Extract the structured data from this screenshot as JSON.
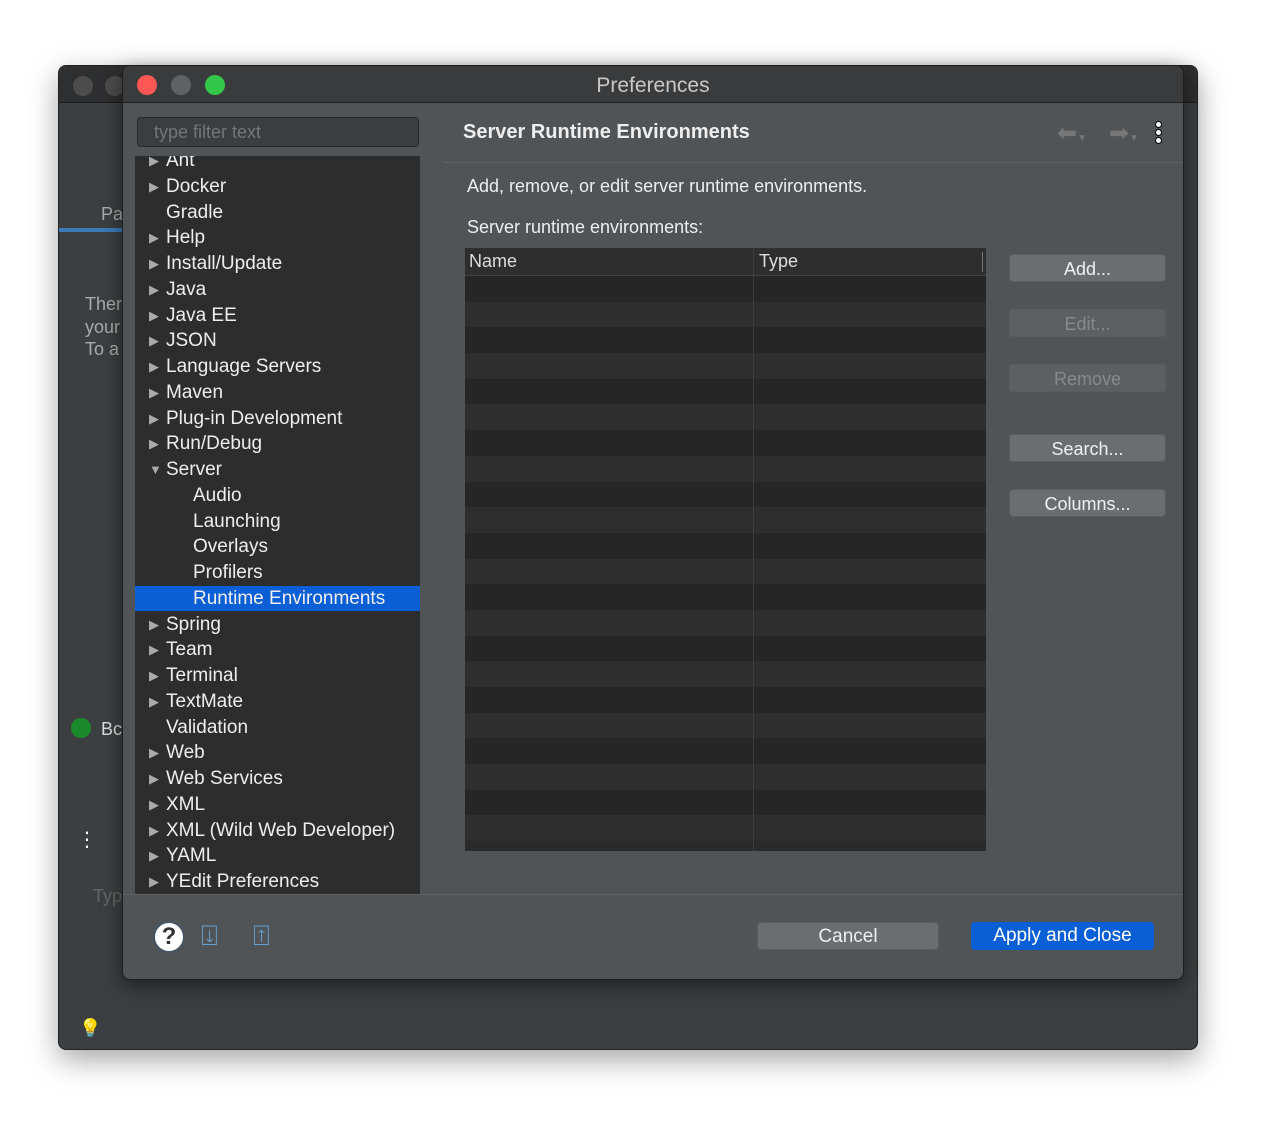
{
  "background_window": {
    "partial_texts": [
      "Pa",
      "Ther",
      "your",
      "To a",
      "Bc",
      "Typ"
    ]
  },
  "dialog": {
    "title": "Preferences"
  },
  "filter": {
    "placeholder": "type filter text"
  },
  "tree": [
    {
      "label": "Ant",
      "expandable": true
    },
    {
      "label": "Docker",
      "expandable": true
    },
    {
      "label": "Gradle",
      "expandable": false
    },
    {
      "label": "Help",
      "expandable": true
    },
    {
      "label": "Install/Update",
      "expandable": true
    },
    {
      "label": "Java",
      "expandable": true
    },
    {
      "label": "Java EE",
      "expandable": true
    },
    {
      "label": "JSON",
      "expandable": true
    },
    {
      "label": "Language Servers",
      "expandable": true
    },
    {
      "label": "Maven",
      "expandable": true
    },
    {
      "label": "Plug-in Development",
      "expandable": true
    },
    {
      "label": "Run/Debug",
      "expandable": true
    },
    {
      "label": "Server",
      "expandable": true,
      "expanded": true
    },
    {
      "label": "Audio",
      "child": true
    },
    {
      "label": "Launching",
      "child": true
    },
    {
      "label": "Overlays",
      "child": true
    },
    {
      "label": "Profilers",
      "child": true
    },
    {
      "label": "Runtime Environments",
      "child": true,
      "selected": true
    },
    {
      "label": "Spring",
      "expandable": true
    },
    {
      "label": "Team",
      "expandable": true
    },
    {
      "label": "Terminal",
      "expandable": true
    },
    {
      "label": "TextMate",
      "expandable": true
    },
    {
      "label": "Validation",
      "expandable": false
    },
    {
      "label": "Web",
      "expandable": true
    },
    {
      "label": "Web Services",
      "expandable": true
    },
    {
      "label": "XML",
      "expandable": true
    },
    {
      "label": "XML (Wild Web Developer)",
      "expandable": true
    },
    {
      "label": "YAML",
      "expandable": true
    },
    {
      "label": "YEdit Preferences",
      "expandable": true
    }
  ],
  "page": {
    "title": "Server Runtime Environments",
    "description": "Add, remove, or edit server runtime environments.",
    "table_label": "Server runtime environments:",
    "columns": [
      "Name",
      "Type"
    ],
    "rows": []
  },
  "buttons": {
    "add": "Add...",
    "edit": "Edit...",
    "remove": "Remove",
    "search": "Search...",
    "columns": "Columns...",
    "cancel": "Cancel",
    "apply_close": "Apply and Close"
  },
  "colors": {
    "accent": "#0b5fd6",
    "close": "#fc5753",
    "minimize": "#5f6163",
    "zoom": "#34c84a"
  }
}
